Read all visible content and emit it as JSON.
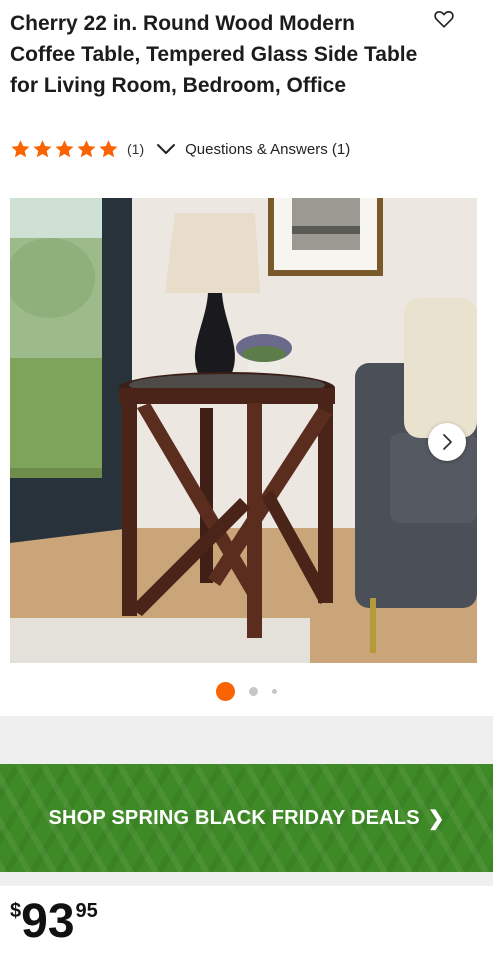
{
  "product": {
    "title": "Cherry 22 in. Round Wood Modern Coffee Table, Tempered Glass Side Table for Living Room, Bedroom, Office",
    "rating": 5,
    "review_count": "(1)",
    "qa_label": "Questions & Answers (1)",
    "images_total": 3,
    "image_index": 1
  },
  "promo": {
    "label": "SHOP SPRING BLACK FRIDAY DEALS",
    "chevron": "❯"
  },
  "price": {
    "symbol": "$",
    "dollars": "93",
    "cents": "95"
  },
  "colors": {
    "accent": "#f96302",
    "promo_green": "#3e8a26",
    "star": "#f96302"
  },
  "icons": {
    "favorite": "heart-outline-icon",
    "qa_toggle": "chevron-down-icon",
    "next_image": "chevron-right-icon",
    "rating": "star-icon"
  }
}
